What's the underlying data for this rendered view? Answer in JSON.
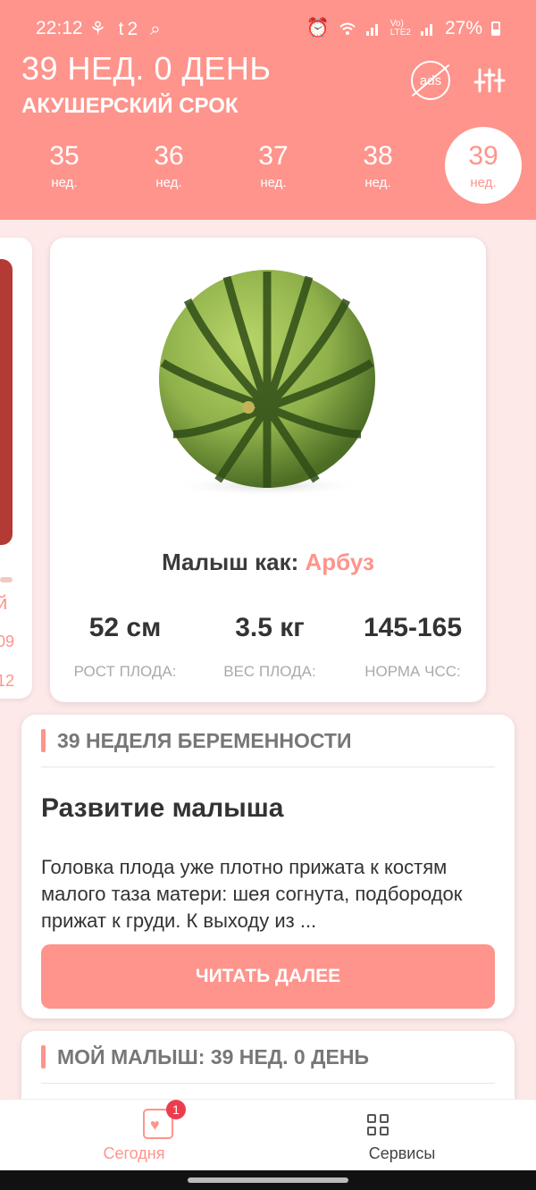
{
  "status_bar": {
    "time": "22:12",
    "left_icons": "⚘ t2 ⌕",
    "battery": "27%",
    "icons": [
      "alarm-icon",
      "wifi-icon",
      "signal-icon",
      "volte-icon",
      "signal-icon",
      "battery-icon"
    ]
  },
  "header": {
    "title": "39 НЕД. 0 ДЕНЬ",
    "subtitle": "АКУШЕРСКИЙ СРОК",
    "ads_label": "ads",
    "weeks": [
      {
        "num": "35",
        "unit": "нед."
      },
      {
        "num": "36",
        "unit": "нед."
      },
      {
        "num": "37",
        "unit": "нед."
      },
      {
        "num": "38",
        "unit": "нед."
      },
      {
        "num": "39",
        "unit": "нед."
      }
    ],
    "active_week": "39"
  },
  "left_card": {
    "text1": "й",
    "text2": "09",
    "text3": "12"
  },
  "baby_card": {
    "compare_prefix": "Малыш как: ",
    "compare_value": "Арбуз",
    "stats": [
      {
        "value": "52 см",
        "label": "РОСТ ПЛОДА:"
      },
      {
        "value": "3.5 кг",
        "label": "ВЕС ПЛОДА:"
      },
      {
        "value": "145-165",
        "label": "НОРМА ЧСС:"
      }
    ]
  },
  "info_card": {
    "section": "39 НЕДЕЛЯ БЕРЕМЕННОСТИ",
    "title": "Развитие малыша",
    "text": "Головка плода уже плотно прижата к костям малого таза матери: шея согнута, подбородок прижат к груди. К выходу из ...",
    "button": "ЧИТАТЬ ДАЛЕЕ"
  },
  "second_card": {
    "section": "МОЙ МАЛЫШ: 39 НЕД. 0 ДЕНЬ"
  },
  "bottom_nav": {
    "today": "Сегодня",
    "today_badge": "1",
    "services": "Сервисы"
  },
  "colors": {
    "accent": "#fe948c",
    "background": "#fde9e8",
    "badge": "#ec3d4f"
  }
}
